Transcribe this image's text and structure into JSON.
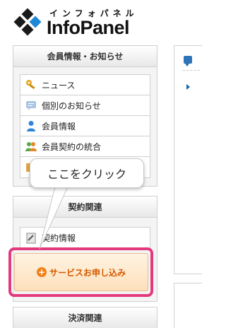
{
  "logo": {
    "kana": "インフォパネル",
    "wordmark": "InfoPanel"
  },
  "member_panel": {
    "title": "会員情報・お知らせ",
    "items": [
      {
        "label": "ニュース",
        "icon": "key-icon"
      },
      {
        "label": "個別のお知らせ",
        "icon": "message-icon"
      },
      {
        "label": "会員情報",
        "icon": "user-icon"
      },
      {
        "label": "会員契約の統合",
        "icon": "merge-users-icon"
      },
      {
        "label": "",
        "icon": "folder-icon"
      }
    ]
  },
  "callout": {
    "text": "ここをクリック"
  },
  "contract_panel": {
    "title": "契約関連",
    "items": [
      {
        "label": "契約情報",
        "icon": "document-icon"
      }
    ],
    "service_button": "サービスお申し込み"
  },
  "payment_panel": {
    "title": "決済関連"
  },
  "colors": {
    "highlight": "#e23a7d",
    "brand_blue": "#1e88d8",
    "button_text": "#d25a00"
  }
}
